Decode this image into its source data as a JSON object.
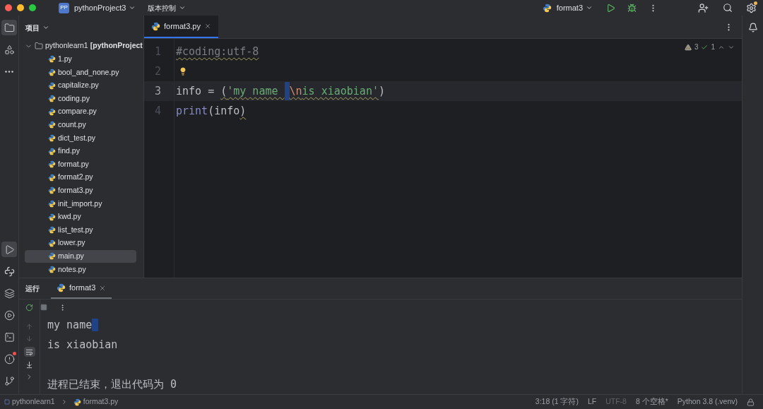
{
  "titlebar": {
    "project_badge": "PP",
    "project": "pythonProject3",
    "vcs": "版本控制",
    "run_config": "format3"
  },
  "tool_windows_top": [
    {
      "kind": "project",
      "selected": true
    },
    {
      "kind": "structure",
      "selected": false
    },
    {
      "kind": "more",
      "selected": false
    }
  ],
  "tool_windows_bottom": [
    {
      "kind": "run",
      "selected": true
    },
    {
      "kind": "python",
      "selected": false
    },
    {
      "kind": "layers",
      "selected": false
    },
    {
      "kind": "services",
      "selected": false
    },
    {
      "kind": "terminal",
      "selected": false
    },
    {
      "kind": "problems",
      "selected": false
    },
    {
      "kind": "git",
      "selected": false
    }
  ],
  "project_panel": {
    "title": "项目",
    "tree": [
      {
        "label": "pythonlearn1",
        "suffix": "[pythonProject",
        "expanded": true,
        "selected": false,
        "children": [
          {
            "label": "1.py",
            "selected": false
          },
          {
            "label": "bool_and_none.py",
            "selected": false
          },
          {
            "label": "capitalize.py",
            "selected": false
          },
          {
            "label": "coding.py",
            "selected": false
          },
          {
            "label": "compare.py",
            "selected": false
          },
          {
            "label": "count.py",
            "selected": false
          },
          {
            "label": "dict_test.py",
            "selected": false
          },
          {
            "label": "find.py",
            "selected": false
          },
          {
            "label": "format.py",
            "selected": false
          },
          {
            "label": "format2.py",
            "selected": false
          },
          {
            "label": "format3.py",
            "selected": false
          },
          {
            "label": "init_import.py",
            "selected": false
          },
          {
            "label": "kwd.py",
            "selected": false
          },
          {
            "label": "list_test.py",
            "selected": false
          },
          {
            "label": "lower.py",
            "selected": false
          },
          {
            "label": "main.py",
            "selected": true
          },
          {
            "label": "notes.py",
            "selected": false
          }
        ]
      }
    ]
  },
  "editor": {
    "tabs": [
      {
        "label": "format3.py",
        "selected": true
      }
    ],
    "warnings": "3",
    "typos": "1",
    "lines": [
      {
        "number": "1",
        "current": false,
        "tokens": [
          {
            "text": "#coding:utf-8",
            "kind": "comment",
            "squiggle": true
          }
        ]
      },
      {
        "number": "2",
        "current": false,
        "bulb": true
      },
      {
        "number": "3",
        "current": true,
        "tokens": [
          {
            "text": "info = ",
            "kind": "plain",
            "squiggle": false
          },
          {
            "text": "(",
            "kind": "plain",
            "squiggle": true
          },
          {
            "text": "'my name ",
            "kind": "string",
            "squiggle": true
          },
          {
            "text": "\\n",
            "kind": "escape",
            "squiggle": true,
            "caret": true
          },
          {
            "text": "is xiaobian'",
            "kind": "string",
            "squiggle": true
          },
          {
            "text": ")",
            "kind": "plain",
            "squiggle": false
          }
        ]
      },
      {
        "number": "4",
        "current": false,
        "tokens": [
          {
            "text": "print",
            "kind": "builtin",
            "squiggle": false
          },
          {
            "text": "(info",
            "kind": "plain",
            "squiggle": false
          },
          {
            "text": ")",
            "kind": "plain",
            "squiggle": true
          }
        ]
      }
    ]
  },
  "run_panel": {
    "title": "运行",
    "tabs": [
      {
        "label": "format3",
        "selected": true
      }
    ],
    "output": [
      {
        "text": "my name",
        "caret": true
      },
      {
        "text": "is xiaobian",
        "caret": false
      },
      {
        "caret": false
      },
      {
        "text": "进程已结束，退出代码为 0",
        "caret": false
      }
    ]
  },
  "status_bar": {
    "breadcrumb": [
      "pythonlearn1",
      "format3.py"
    ],
    "items": [
      {
        "text": "3:18 (1 字符)",
        "dim": false
      },
      {
        "text": "LF",
        "dim": false
      },
      {
        "text": "UTF-8",
        "dim": true
      },
      {
        "text": "8 个空格*",
        "dim": false
      },
      {
        "text": "Python 3.8 (.venv)",
        "dim": false
      }
    ]
  }
}
